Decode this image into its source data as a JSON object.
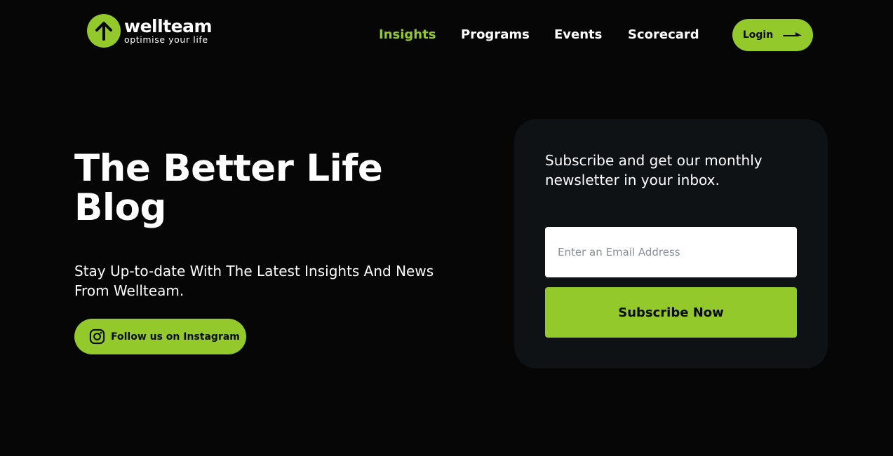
{
  "brand": {
    "name": "wellteam",
    "tagline": "optimise your life",
    "accent_color": "#94c92b",
    "background_color": "#060606",
    "card_color": "#0f1215"
  },
  "nav": {
    "items": [
      {
        "label": "Insights",
        "active": true
      },
      {
        "label": "Programs",
        "active": false
      },
      {
        "label": "Events",
        "active": false
      },
      {
        "label": "Scorecard",
        "active": false
      }
    ],
    "login_label": "Login",
    "login_icon": "arrow-right-icon"
  },
  "hero": {
    "title": "The Better Life Blog",
    "subtitle": "Stay Up-to-date With The Latest Insights And News From Wellteam.",
    "instagram_label": "Follow us on Instagram",
    "instagram_icon": "instagram-icon"
  },
  "newsletter": {
    "text": "Subscribe and get our monthly newsletter in your inbox.",
    "email_value": "",
    "email_placeholder": "Enter an Email Address",
    "subscribe_label": "Subscribe Now"
  }
}
